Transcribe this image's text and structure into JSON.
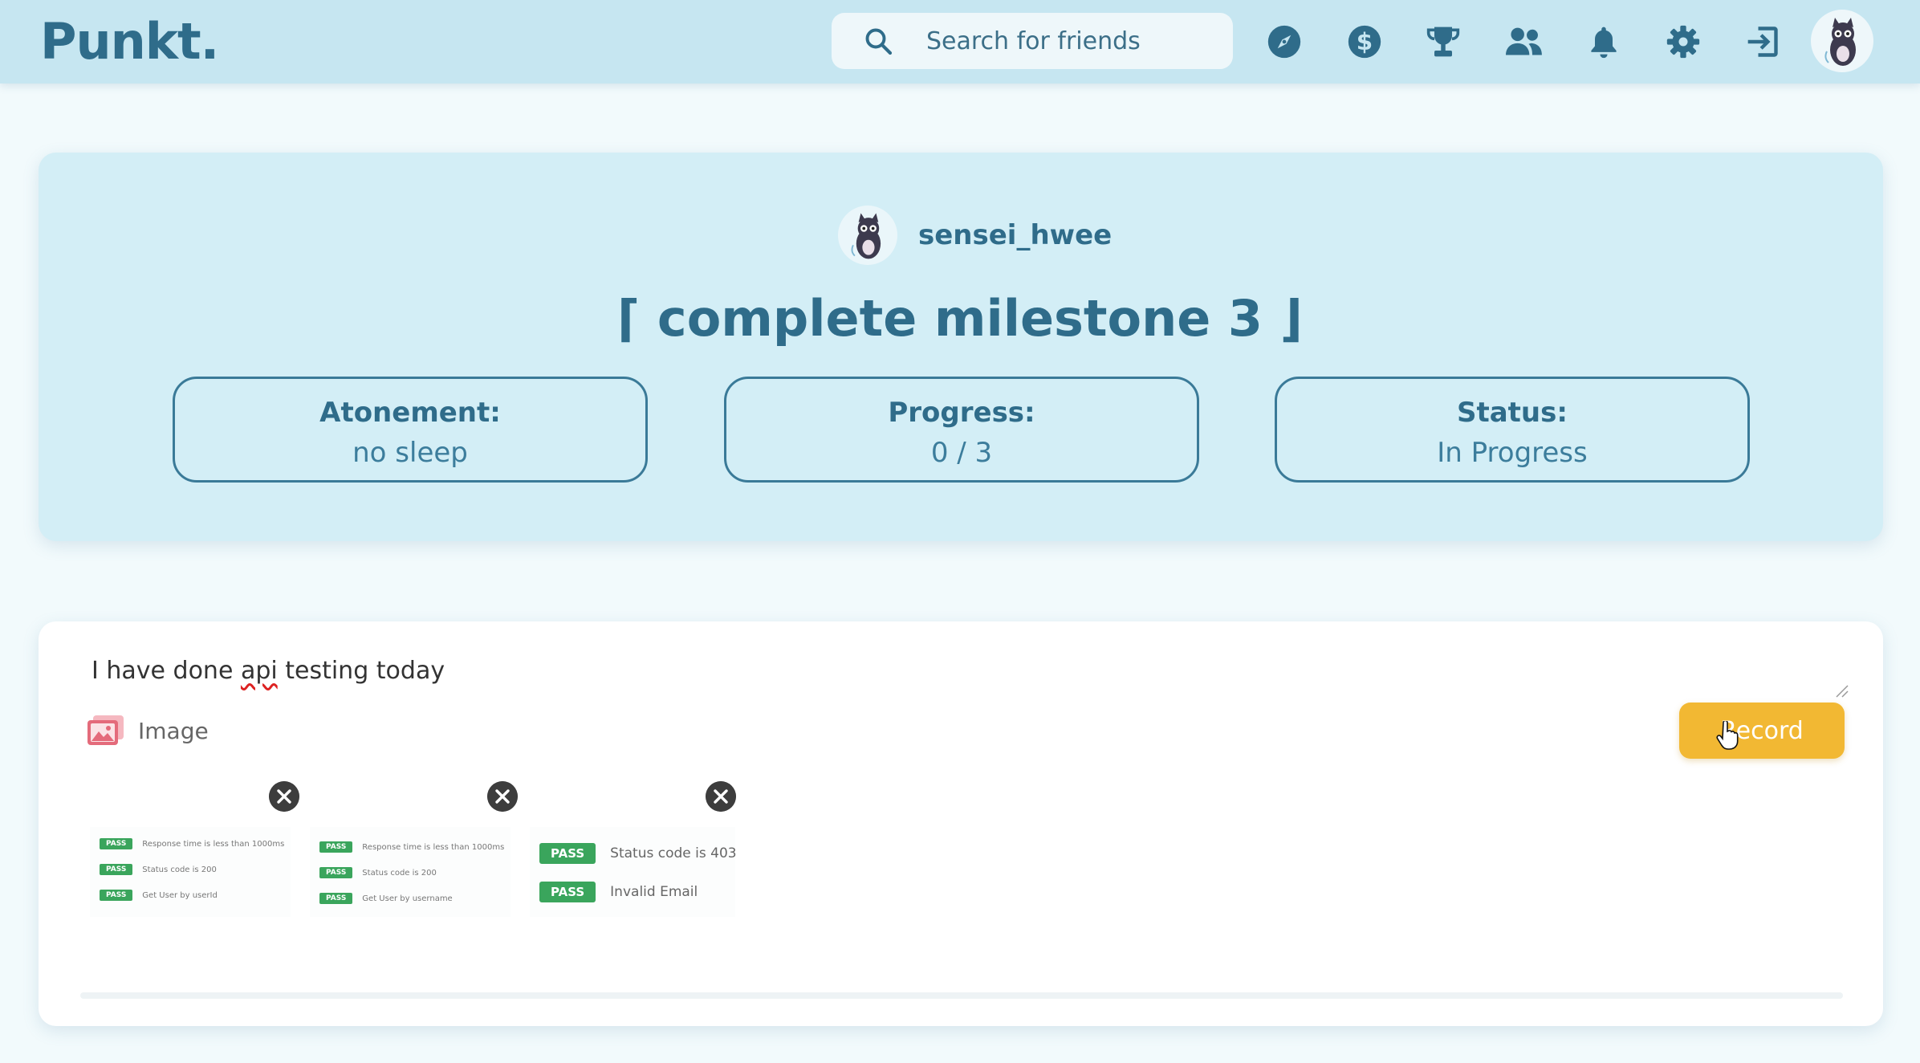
{
  "app": {
    "logo": "Punkt."
  },
  "header": {
    "search_placeholder": "Search for friends",
    "nav_icons": [
      "compass-icon",
      "dollar-icon",
      "trophy-icon",
      "friends-icon",
      "bell-icon",
      "gear-icon",
      "logout-icon"
    ]
  },
  "challenge": {
    "username": "sensei_hwee",
    "title": "⌈ complete milestone 3 ⌋",
    "stats": [
      {
        "label": "Atonement:",
        "value": "no sleep"
      },
      {
        "label": "Progress:",
        "value": "0 / 3"
      },
      {
        "label": "Status:",
        "value": "In Progress"
      }
    ]
  },
  "record": {
    "note_before": "I have done ",
    "note_misspelled": "api",
    "note_after": " testing today",
    "image_label": "Image",
    "record_button": "Record",
    "thumbnails": [
      {
        "rows": [
          {
            "badge": "PASS",
            "text": "Response time is less than 1000ms"
          },
          {
            "badge": "PASS",
            "text": "Status code is 200"
          },
          {
            "badge": "PASS",
            "text": "Get User by userId"
          }
        ]
      },
      {
        "rows": [
          {
            "badge": "PASS",
            "text": "Response time is less than 1000ms"
          },
          {
            "badge": "PASS",
            "text": "Status code is 200"
          },
          {
            "badge": "PASS",
            "text": "Get User by username"
          }
        ]
      },
      {
        "rows": [
          {
            "badge": "PASS",
            "text": "Status code is 403"
          },
          {
            "badge": "PASS",
            "text": "Invalid Email"
          }
        ]
      }
    ]
  },
  "colors": {
    "header_bg": "#c6e6f1",
    "primary_text": "#2f6c8a",
    "card_bg": "#d3eef6",
    "record_button": "#f2b833",
    "pass_badge": "#3aa55c",
    "image_icon": "#e46b7b"
  }
}
